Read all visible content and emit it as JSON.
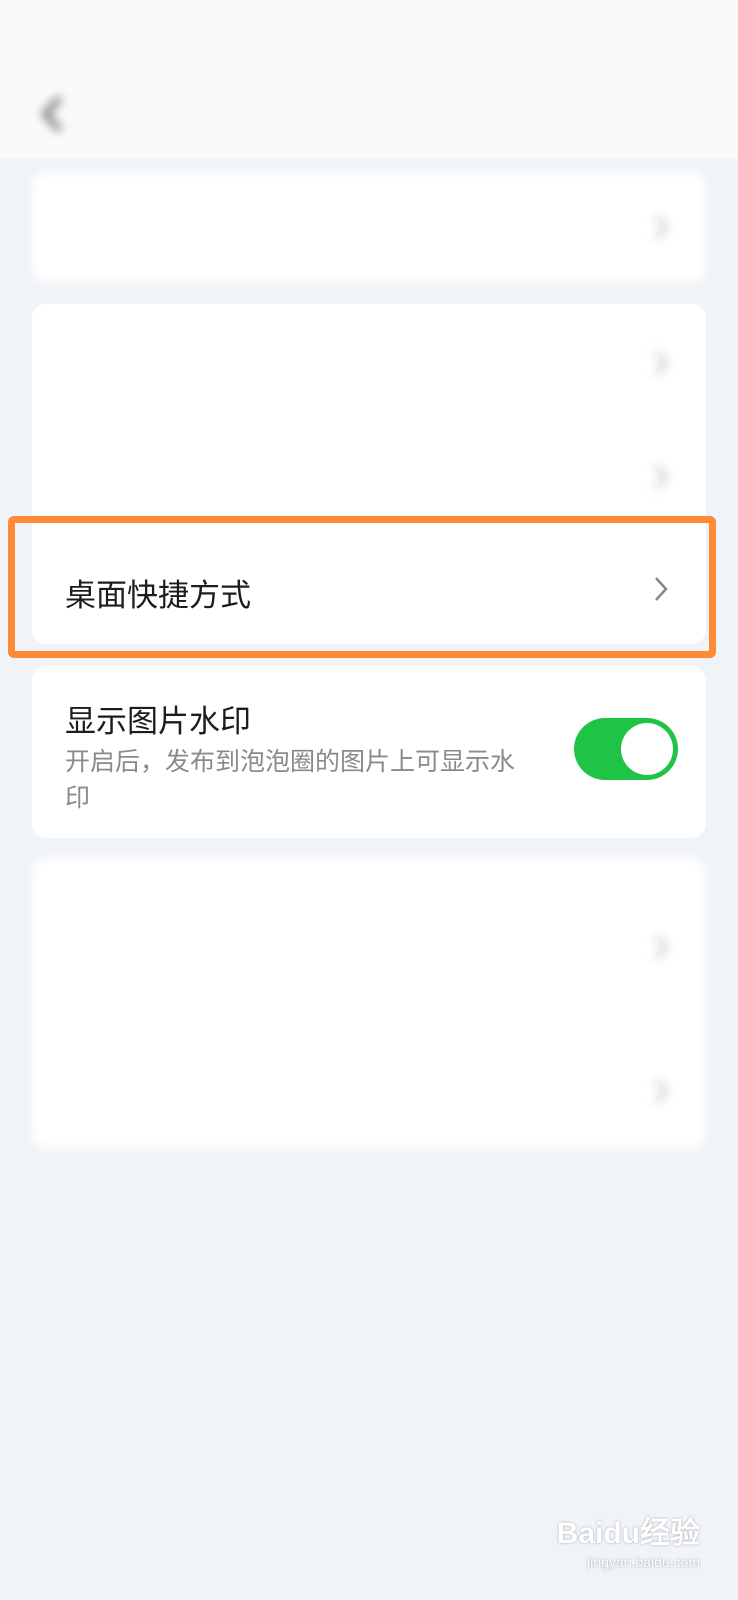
{
  "status_bar": {
    "time": "",
    "icons": ""
  },
  "navbar": {
    "title": ""
  },
  "section1": {
    "item1": {
      "label": "",
      "value": ""
    }
  },
  "section2": {
    "item1": {
      "label": ""
    },
    "item2": {
      "label": ""
    },
    "item3": {
      "label": "桌面快捷方式"
    }
  },
  "section3": {
    "watermark_toggle": {
      "label": "显示图片水印",
      "description": "开启后，发布到泡泡圈的图片上可显示水印",
      "enabled": true
    }
  },
  "section4": {
    "item1": {
      "label": "",
      "description": ""
    },
    "item2": {
      "label": ""
    }
  },
  "watermark_overlay": {
    "logo": "Baidu经验",
    "url": "jingyan.baidu.com"
  },
  "colors": {
    "toggle_on": "#1fc345",
    "highlight_border": "#fe8a36",
    "background": "#f0f3f7"
  },
  "icons": {
    "back": "chevron-left-icon",
    "row_arrow": "chevron-right-icon"
  }
}
